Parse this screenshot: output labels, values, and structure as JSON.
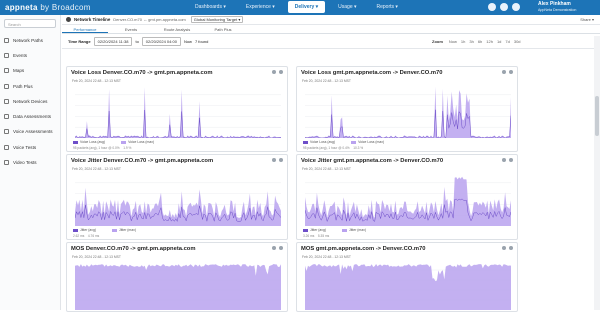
{
  "app": {
    "brand": "appneta",
    "brand_sub": "by Broadcom"
  },
  "nav": [
    {
      "label": "Dashboards ▾",
      "active": false
    },
    {
      "label": "Experience ▾",
      "active": false
    },
    {
      "label": "Delivery ▾",
      "active": true
    },
    {
      "label": "Usage ▾",
      "active": false
    },
    {
      "label": "Reports ▾",
      "active": false
    }
  ],
  "user": {
    "name": "Alex Pinkham",
    "org": "AppNeta Demonstration"
  },
  "sidebar": {
    "search_placeholder": "Search",
    "items": [
      "Network Paths",
      "Events",
      "Maps",
      "Path Plus",
      "Network Devices",
      "Data Assessments",
      "Voice Assessments",
      "Voice Tests",
      "Video Tests"
    ]
  },
  "header": {
    "title": "Network Timeline",
    "subtitle": "Denver.CO.m70 ↔ gmt.pm.appneta.com",
    "dropdown": "Global Monitoring Target ▾",
    "share": "Share ▾"
  },
  "tabs": [
    "Performance",
    "Events",
    "Route Analysis",
    "Path Plus"
  ],
  "timerange": {
    "label": "Time Range",
    "from": "02/20/2024 11:38",
    "to": "02/20/2024 04:00",
    "to_label": "to",
    "now_label": "Now",
    "found": "7 found",
    "zoom_label": "Zoom",
    "zoom_options": [
      "Now",
      "1h",
      "3h",
      "6h",
      "12h",
      "1d",
      "7d",
      "30d"
    ]
  },
  "panels": [
    {
      "title": "Voice Loss Denver.CO.m70 -> gmt.pm.appneta.com",
      "date": "Feb 20, 2024 22:48 - 12:13 MST",
      "legend_a": "Voice Loss (avg)",
      "legend_b": "Voice Loss (max)",
      "foot_a": "95 packets (avg), 1 hour @ 0.0%",
      "foot_b": "1.9 %"
    },
    {
      "title": "Voice Loss gmt.pm.appneta.com -> Denver.CO.m70",
      "date": "Feb 20, 2024 22:48 - 12:13 MST",
      "legend_a": "Voice Loss (avg)",
      "legend_b": "Voice Loss (max)",
      "foot_a": "95 packets (avg), 1 hour @ 0.4%",
      "foot_b": "10.3 %"
    },
    {
      "title": "Voice Jitter Denver.CO.m70 -> gmt.pm.appneta.com",
      "date": "Feb 20, 2024 22:48 - 12:13 MST",
      "legend_a": "Jitter (avg)",
      "legend_b": "Jitter (max)",
      "foot_a": "2.62 ms",
      "foot_b": "4.76 ms"
    },
    {
      "title": "Voice Jitter gmt.pm.appneta.com -> Denver.CO.m70",
      "date": "Feb 20, 2024 22:48 - 12:13 MST",
      "legend_a": "Jitter (avg)",
      "legend_b": "Jitter (max)",
      "foot_a": "3.26 ms",
      "foot_b": "5.35 ms"
    },
    {
      "title": "MOS Denver.CO.m70 -> gmt.pm.appneta.com",
      "date": "Feb 20, 2024 22:48 - 12:13 MST",
      "legend_a": "",
      "legend_b": "",
      "foot_a": "",
      "foot_b": ""
    },
    {
      "title": "MOS gmt.pm.appneta.com -> Denver.CO.m70",
      "date": "Feb 20, 2024 22:48 - 12:13 MST",
      "legend_a": "",
      "legend_b": "",
      "foot_a": "",
      "foot_b": ""
    }
  ],
  "colors": {
    "accent": "#1d74b7",
    "series": "#b9a2ef",
    "series_line": "#6e4fc9"
  }
}
